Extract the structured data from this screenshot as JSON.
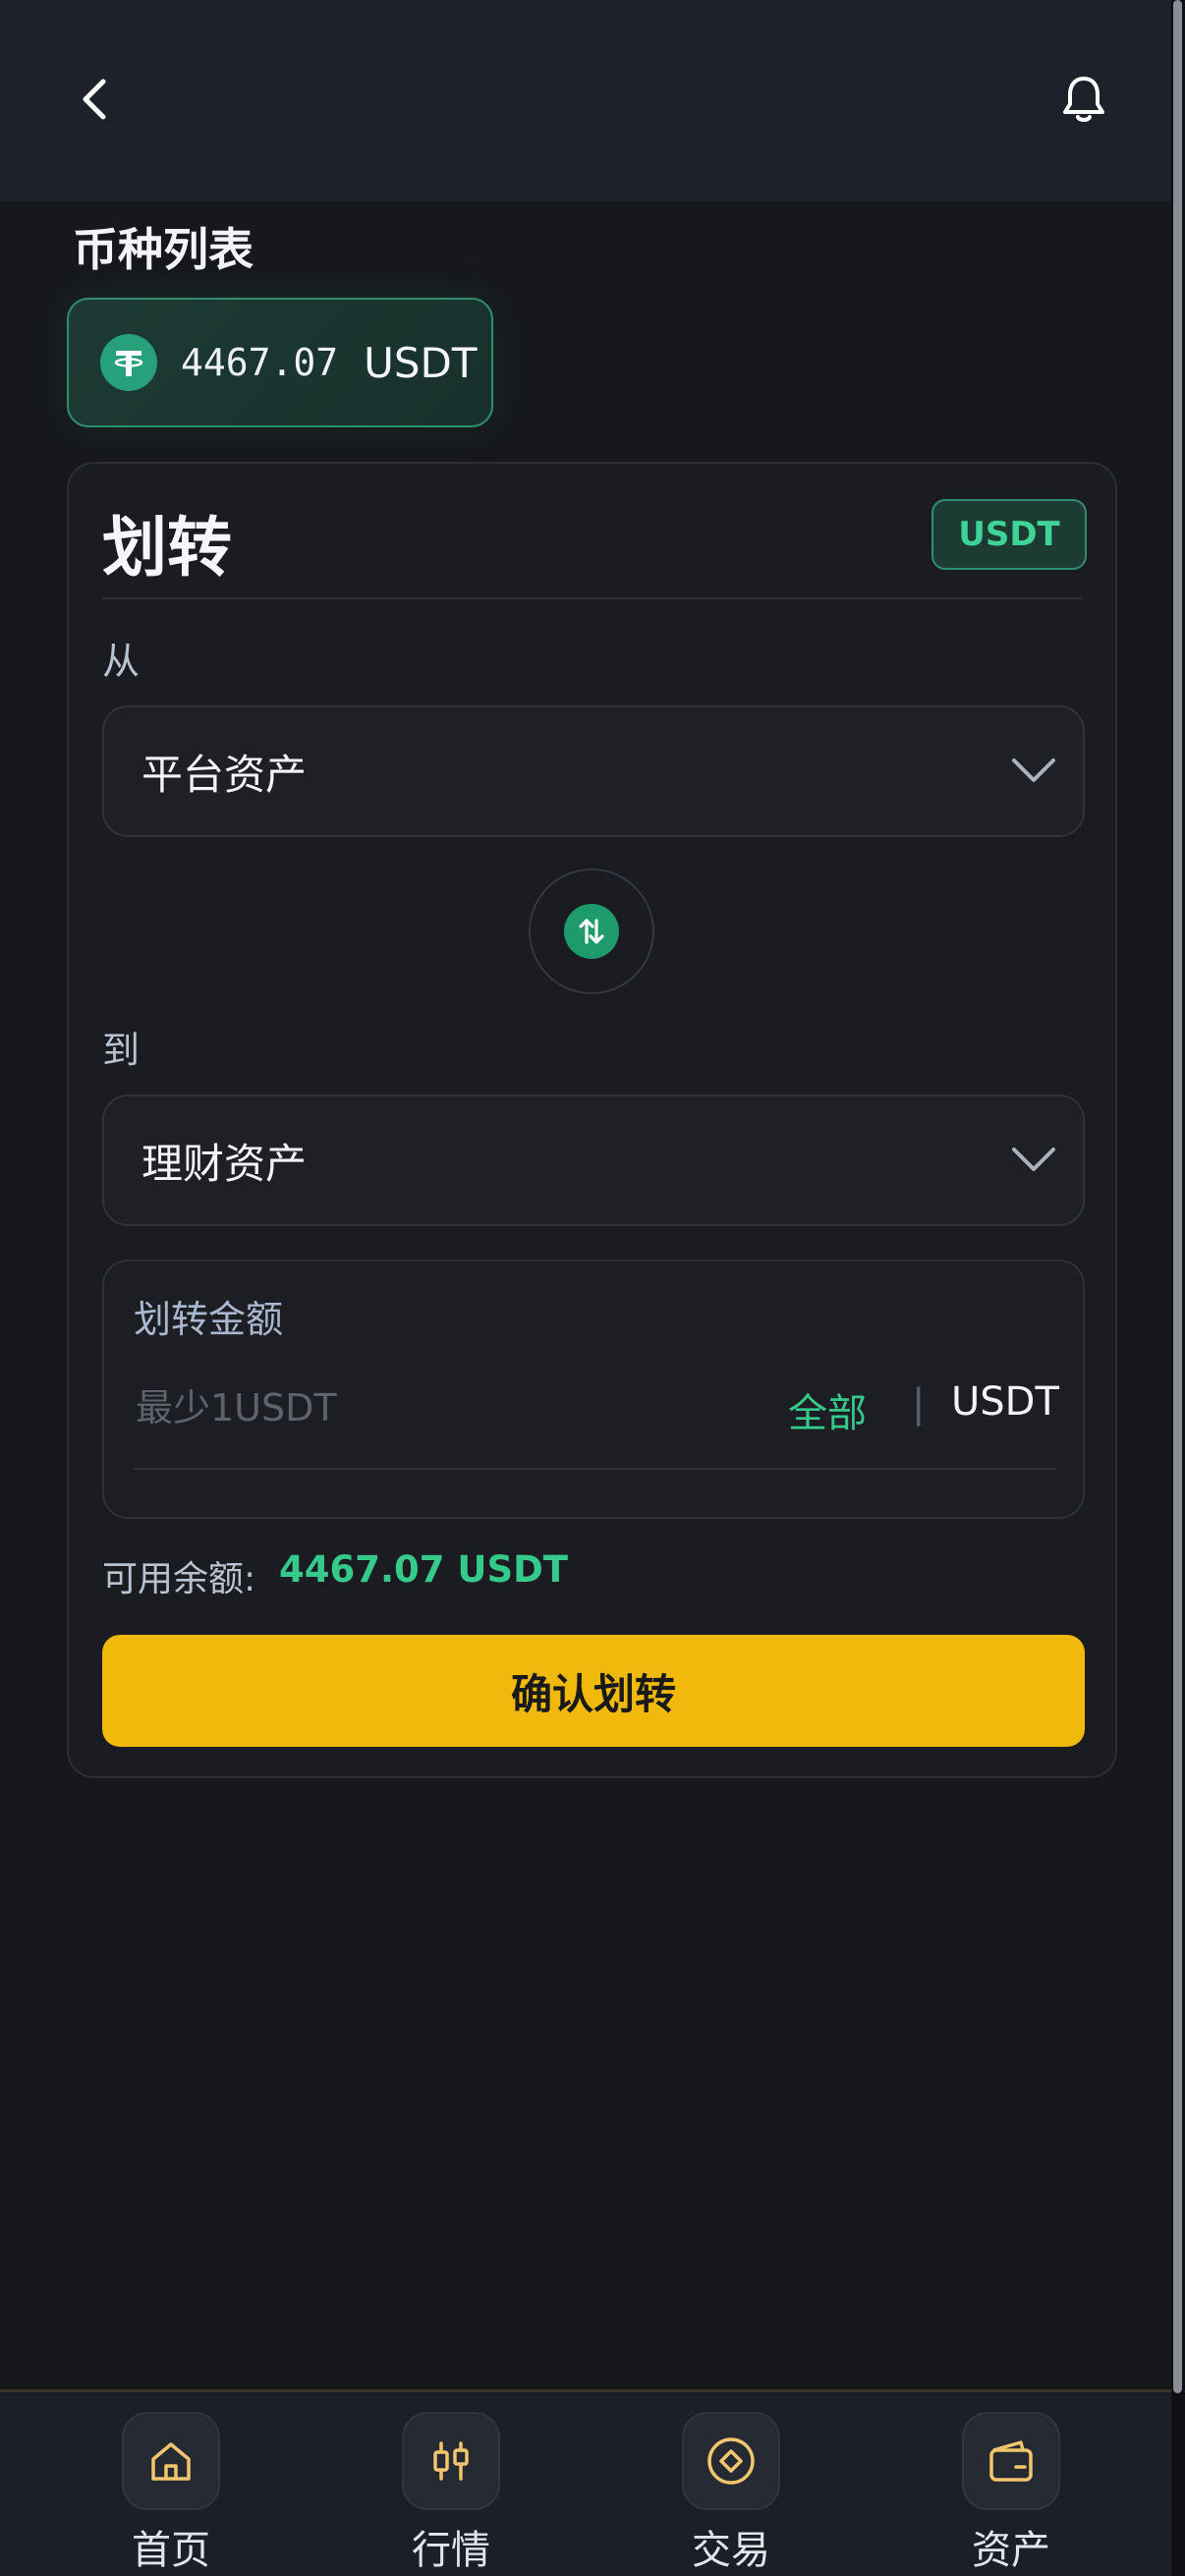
{
  "header": {
    "back_icon": "chevron-left-icon",
    "bell_icon": "bell-icon"
  },
  "coin_list": {
    "title": "币种列表",
    "items": [
      {
        "icon": "tether-icon",
        "amount": "4467.07",
        "unit": "USDT"
      }
    ]
  },
  "transfer": {
    "title": "划转",
    "badge": "USDT",
    "from_label": "从",
    "from_value": "平台资产",
    "to_label": "到",
    "to_value": "理财资产",
    "amount_label": "划转金额",
    "amount_placeholder": "最少1USDT",
    "all_label": "全部",
    "separator": "|",
    "amount_unit": "USDT",
    "available_label": "可用余额:",
    "available_value": "4467.07 USDT",
    "confirm_label": "确认划转"
  },
  "nav": {
    "items": [
      {
        "label": "首页",
        "icon": "home-icon"
      },
      {
        "label": "行情",
        "icon": "candlestick-icon"
      },
      {
        "label": "交易",
        "icon": "trade-icon"
      },
      {
        "label": "资产",
        "icon": "wallet-icon"
      }
    ]
  },
  "colors": {
    "accent_green": "#35c98b",
    "primary_yellow": "#f0b90b",
    "background": "#17181c"
  }
}
